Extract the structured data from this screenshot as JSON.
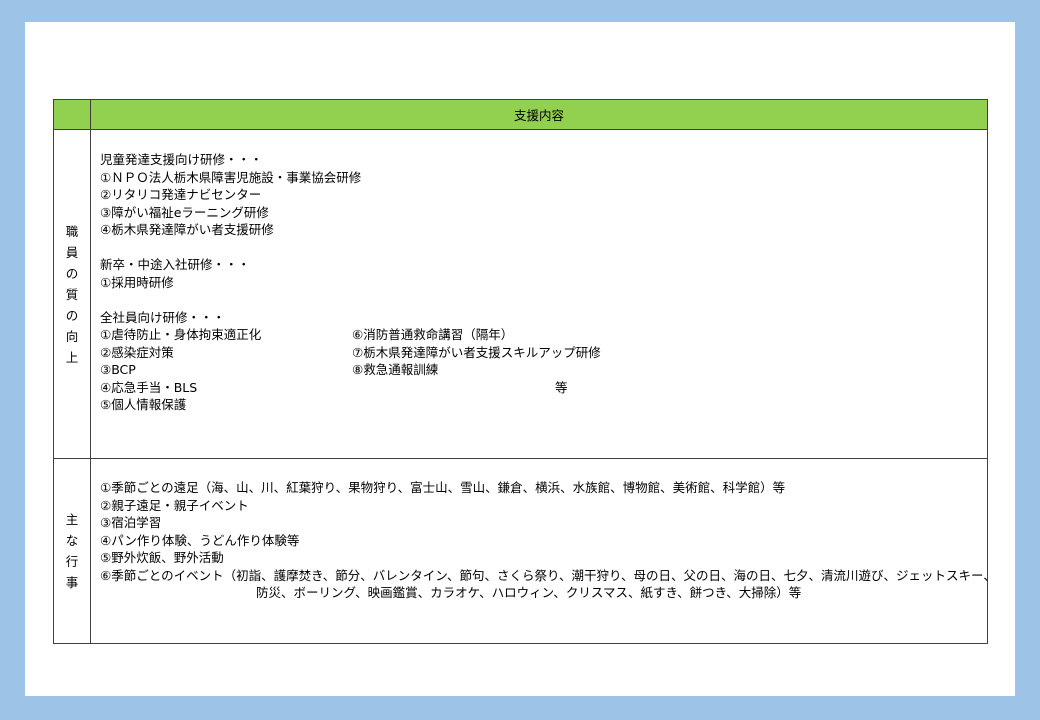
{
  "header": {
    "label": "支援内容"
  },
  "staff": {
    "side_label": [
      "職",
      "員",
      "の",
      "質",
      "の",
      "向",
      "上"
    ],
    "child_dev_title": "児童発達支援向け研修・・・",
    "child_dev_items": [
      "①ＮＰＯ法人栃木県障害児施設・事業協会研修",
      "②リタリコ発達ナビセンター",
      "③障がい福祉eラーニング研修",
      "④栃木県発達障がい者支援研修"
    ],
    "new_hire_title": "新卒・中途入社研修・・・",
    "new_hire_items": [
      "①採用時研修"
    ],
    "all_staff_title": "全社員向け研修・・・",
    "all_staff_left": [
      "①虐待防止・身体拘束適正化",
      "②感染症対策",
      "③BCP",
      "④応急手当・BLS",
      "⑤個人情報保護"
    ],
    "all_staff_right": [
      "⑥消防普通救命講習（隔年）",
      "⑦栃木県発達障がい者支援スキルアップ研修",
      "⑧救急通報訓練"
    ],
    "etc": "等"
  },
  "events": {
    "side_label": [
      "主",
      "な",
      "行",
      "事"
    ],
    "items": [
      "①季節ごとの遠足（海、山、川、紅葉狩り、果物狩り、富士山、雪山、鎌倉、横浜、水族館、博物館、美術館、科学館）等",
      "②親子遠足・親子イベント",
      "③宿泊学習",
      "④パン作り体験、うどん作り体験等",
      "⑤野外炊飯、野外活動",
      "⑥季節ごとのイベント（初詣、護摩焚き、節分、バレンタイン、節句、さくら祭り、潮干狩り、母の日、父の日、海の日、七夕、清流川遊び、ジェットスキー、"
    ],
    "item6_cont": "防災、ボーリング、映画鑑賞、カラオケ、ハロウィン、クリスマス、紙すき、餅つき、大掃除）等"
  }
}
